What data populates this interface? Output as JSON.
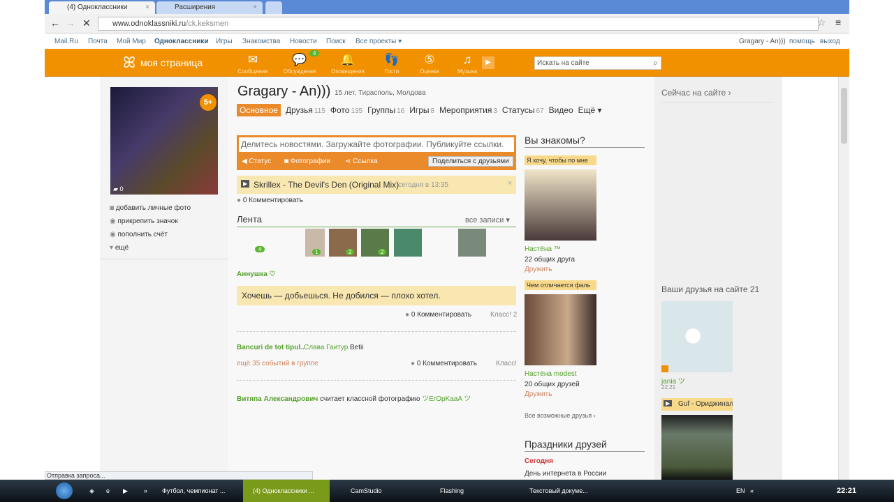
{
  "browser": {
    "tabs": [
      {
        "label": "(4) Одноклассники"
      },
      {
        "label": "Расширения"
      }
    ],
    "url_host": "www.odnoklassniki.ru",
    "url_path": "/ck.keksmen",
    "status": "Отправка запроса..."
  },
  "mailbar": {
    "items": [
      "Mail.Ru",
      "Почта",
      "Мой Мир",
      "Одноклассники",
      "Игры",
      "Знакомства",
      "Новости",
      "Поиск",
      "Все проекты ▾"
    ],
    "user": "Gragary - An)))",
    "help": "помощь",
    "logout": "выход"
  },
  "header": {
    "logo": "моя страница",
    "nav": [
      {
        "label": "Сообщения",
        "icon": "✉"
      },
      {
        "label": "Обсуждения",
        "icon": "💬",
        "badge": "4"
      },
      {
        "label": "Оповещения",
        "icon": "🔔"
      },
      {
        "label": "Гости",
        "icon": "👣"
      },
      {
        "label": "Оценки",
        "icon": "⑤"
      },
      {
        "label": "Музыка",
        "icon": "♫"
      }
    ],
    "search_placeholder": "Искать на сайте"
  },
  "left": {
    "badge": "5+",
    "photo_comments": "0",
    "actions": [
      "добавить личные фото",
      "прикрепить значок",
      "пополнить счёт",
      "ещё"
    ]
  },
  "profile": {
    "name": "Gragary - An)))",
    "info": "15 лет, Тирасполь, Молдова",
    "tabs": [
      {
        "label": "Основное",
        "count": ""
      },
      {
        "label": "Друзья",
        "count": "115"
      },
      {
        "label": "Фото",
        "count": "135"
      },
      {
        "label": "Группы",
        "count": "16"
      },
      {
        "label": "Игры",
        "count": "8"
      },
      {
        "label": "Мероприятия",
        "count": "3"
      },
      {
        "label": "Статусы",
        "count": "67"
      },
      {
        "label": "Видео",
        "count": ""
      },
      {
        "label": "Ещё ▾",
        "count": ""
      }
    ]
  },
  "share": {
    "placeholder": "Делитесь новостями. Загружайте фотографии. Публикуйте ссылки.",
    "status": "Статус",
    "photos": "Фотографии",
    "link": "Ссылка",
    "submit": "Поделиться с друзьями"
  },
  "music_status": {
    "track": "Skrillex - The Devil's Den (Original Mix)",
    "time": "сегодня в 13:35",
    "comments": "0 Комментировать"
  },
  "feed": {
    "title": "Лента",
    "all": "все записи ▾",
    "badges": [
      "4",
      "1",
      "2",
      "2"
    ],
    "post1": {
      "author": "Аннушка ♡",
      "text": "Хочешь — добьешься. Не добился — плохо хотел.",
      "comments": "0 Комментировать",
      "klass": "Класс! 2"
    },
    "post2": {
      "group": "Bancuri de tot tipul..",
      "author": "Слава Гаитур",
      "text": "Betii",
      "more": "ещё 35 событий в группе",
      "comments": "0 Комментировать",
      "klass": "Класс!"
    },
    "post3": {
      "author": "Витяпа Александрович",
      "action": "считает классной фотографию",
      "target": "ツErOpKaaA ツ"
    }
  },
  "know": {
    "title": "Вы знакомы?",
    "people": [
      {
        "caption": "Я хочу, чтобы по мне",
        "name": "Настёна ™",
        "mutual": "22 общих друга",
        "add": "Дружить"
      },
      {
        "caption": "Чем отличается фаль",
        "name": "Настёна modest",
        "mutual": "20 общих друзей",
        "add": "Дружить"
      }
    ],
    "all": "Все возможные друзья ›"
  },
  "holidays": {
    "title": "Праздники друзей",
    "today": "Сегодня",
    "item": "День интернета в России"
  },
  "right": {
    "online": "Сейчас на сайте ›",
    "friends_title": "Ваши друзья на сайте 21",
    "friend": {
      "name": "jania ツ",
      "time": "22:21"
    },
    "music": "Guf - Ориджинал G"
  },
  "taskbar": {
    "items": [
      "Футбол, чемпионат ...",
      "(4) Одноклассники ...",
      "CamStudio",
      "Flashing",
      "Текстовый докуме..."
    ],
    "lang": "EN",
    "clock": "22:21"
  }
}
